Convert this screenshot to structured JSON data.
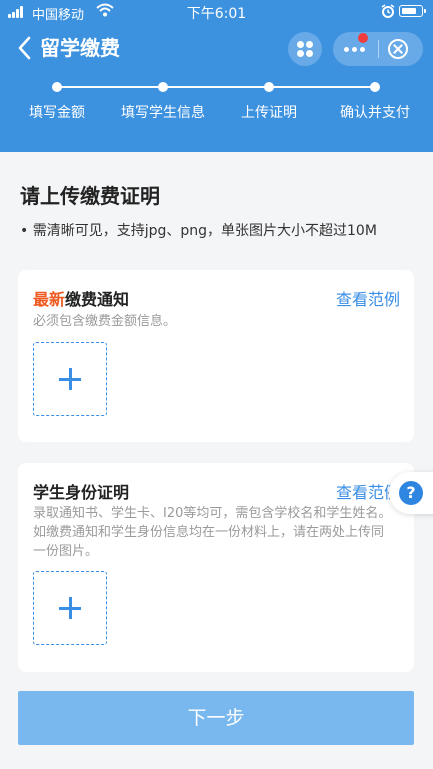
{
  "status_bar": {
    "carrier": "中国移动",
    "time": "下午6:01"
  },
  "nav": {
    "title": "留学缴费"
  },
  "steps": [
    {
      "label": "填写金额"
    },
    {
      "label": "填写学生信息"
    },
    {
      "label": "上传证明"
    },
    {
      "label": "确认并支付"
    }
  ],
  "main": {
    "title": "请上传缴费证明",
    "hint": "• 需清晰可见，支持jpg、png，单张图片大小不超过10M"
  },
  "cards": [
    {
      "title_highlight": "最新",
      "title_rest": "缴费通知",
      "example_link": "查看范例",
      "description": "必须包含缴费金额信息。"
    },
    {
      "title": "学生身份证明",
      "example_link": "查看范例",
      "description": "录取通知书、学生卡、I20等均可，需包含学校名和学生姓名。如缴费通知和学生身份信息均在一份材料上，请在两处上传同一份图片。"
    }
  ],
  "help": {
    "glyph": "?"
  },
  "footer": {
    "next_label": "下一步"
  },
  "colors": {
    "header": "#3d92e0",
    "accent": "#3a8ee6",
    "highlight": "#ef5a22",
    "button_disabled": "#78b8ee"
  },
  "icons": [
    "signal-icon",
    "wifi-icon",
    "alarm-icon",
    "battery-icon",
    "back-arrow-icon",
    "grid-icon",
    "more-icon",
    "close-icon",
    "plus-icon",
    "help-icon"
  ]
}
